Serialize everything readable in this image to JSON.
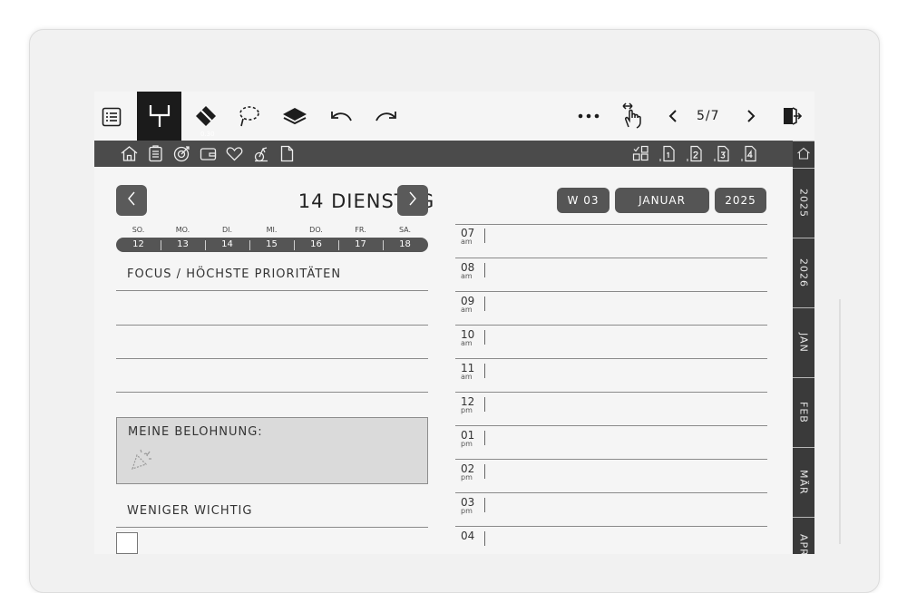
{
  "toolbar": {
    "pen_size": "0.30",
    "page_indicator": "5/7",
    "icons": [
      "menu-icon",
      "pen-icon",
      "eraser-icon",
      "lasso-icon",
      "layers-icon",
      "undo-icon",
      "redo-icon",
      "more-icon",
      "touch-swipe-icon",
      "prev-page-icon",
      "next-page-icon",
      "exit-icon"
    ]
  },
  "iconbar": {
    "left_icons": [
      "home-icon",
      "clipboard-icon",
      "target-icon",
      "wallet-icon",
      "heart-icon",
      "bike-icon",
      "page-icon"
    ],
    "right_icons": [
      "grid-icon",
      "page-1-icon",
      "page-2-icon",
      "page-3-icon",
      "page-4-icon"
    ]
  },
  "tabs": [
    "2025",
    "2026",
    "JAN",
    "FEB",
    "MÄR",
    "APR"
  ],
  "day": {
    "title": "14 DIENSTAG",
    "weekday_labels": [
      "SO.",
      "MO.",
      "DI.",
      "MI.",
      "DO.",
      "FR.",
      "SA."
    ],
    "dates": [
      "12",
      "13",
      "14",
      "15",
      "16",
      "17",
      "18"
    ]
  },
  "focus_label": "FOCUS / HÖCHSTE PRIORITÄTEN",
  "reward_label": "MEINE BELOHNUNG:",
  "less_important_label": "WENIGER WICHTIG",
  "header_pills": {
    "week": "W 03",
    "month": "JANUAR",
    "year": "2025"
  },
  "hours": [
    {
      "h": "07",
      "ap": "am"
    },
    {
      "h": "08",
      "ap": "am"
    },
    {
      "h": "09",
      "ap": "am"
    },
    {
      "h": "10",
      "ap": "am"
    },
    {
      "h": "11",
      "ap": "am"
    },
    {
      "h": "12",
      "ap": "pm"
    },
    {
      "h": "01",
      "ap": "pm"
    },
    {
      "h": "02",
      "ap": "pm"
    },
    {
      "h": "03",
      "ap": "pm"
    },
    {
      "h": "04",
      "ap": ""
    }
  ]
}
